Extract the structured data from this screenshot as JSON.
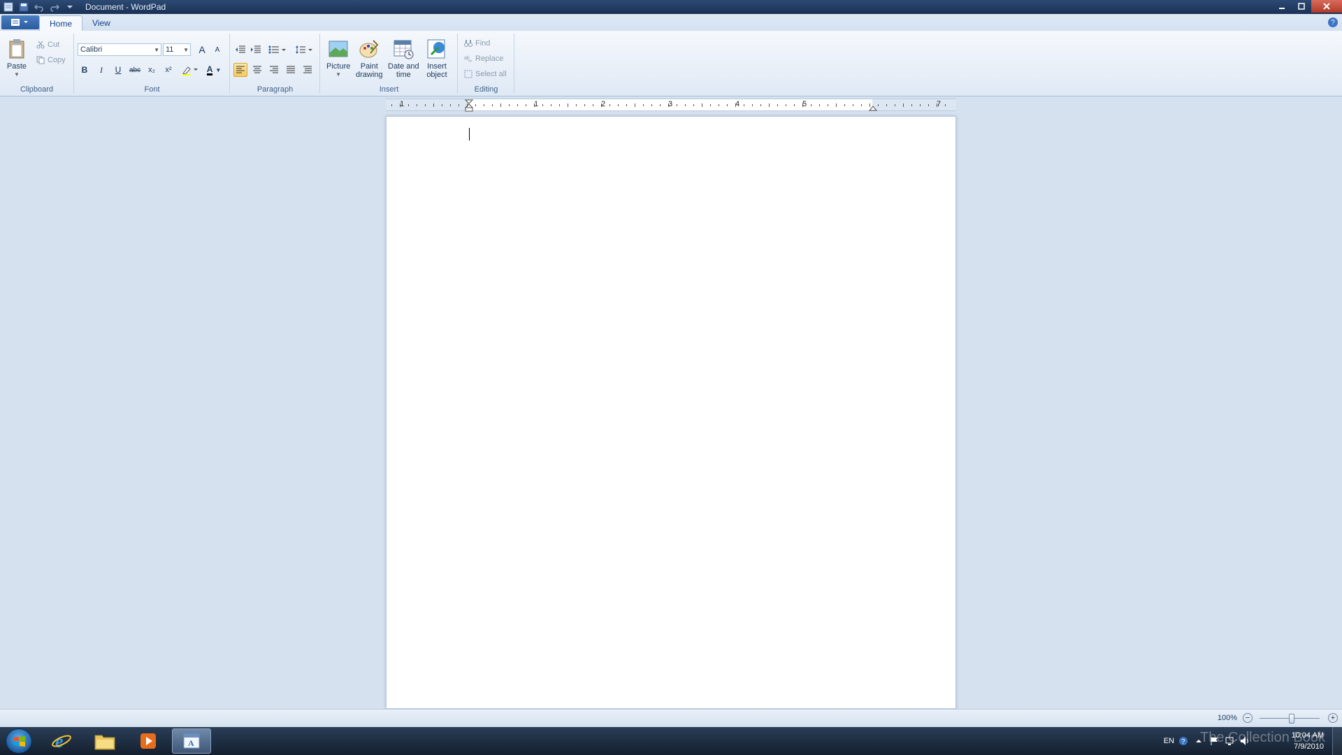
{
  "window": {
    "title": "Document - WordPad"
  },
  "ribbon": {
    "tabs": [
      {
        "label": "Home",
        "active": true
      },
      {
        "label": "View",
        "active": false
      }
    ],
    "clipboard": {
      "label": "Clipboard",
      "paste": "Paste",
      "cut": "Cut",
      "copy": "Copy"
    },
    "font": {
      "label": "Font",
      "family": "Calibri",
      "size": "11",
      "bold": "B",
      "italic": "I",
      "underline": "U",
      "strike": "abc",
      "subscript": "x₂",
      "superscript": "x²",
      "grow": "A",
      "shrink": "A",
      "color": "A"
    },
    "paragraph": {
      "label": "Paragraph"
    },
    "insert": {
      "label": "Insert",
      "picture": "Picture",
      "paint_drawing_1": "Paint",
      "paint_drawing_2": "drawing",
      "date_time_1": "Date and",
      "date_time_2": "time",
      "insert_object_1": "Insert",
      "insert_object_2": "object"
    },
    "editing": {
      "label": "Editing",
      "find": "Find",
      "replace": "Replace",
      "select_all": "Select all"
    }
  },
  "ruler": {
    "numbers": [
      "1",
      "1",
      "2",
      "3",
      "4",
      "5",
      "7"
    ]
  },
  "status": {
    "zoom": "100%"
  },
  "taskbar": {
    "lang": "EN",
    "time": "10:04 AM",
    "date": "7/9/2010",
    "watermark": "The Collection Book"
  },
  "colors": {
    "accent": "#2b5d9f",
    "ribbon_bg": "#dfe9f5",
    "page_bg": "#ffffff"
  }
}
